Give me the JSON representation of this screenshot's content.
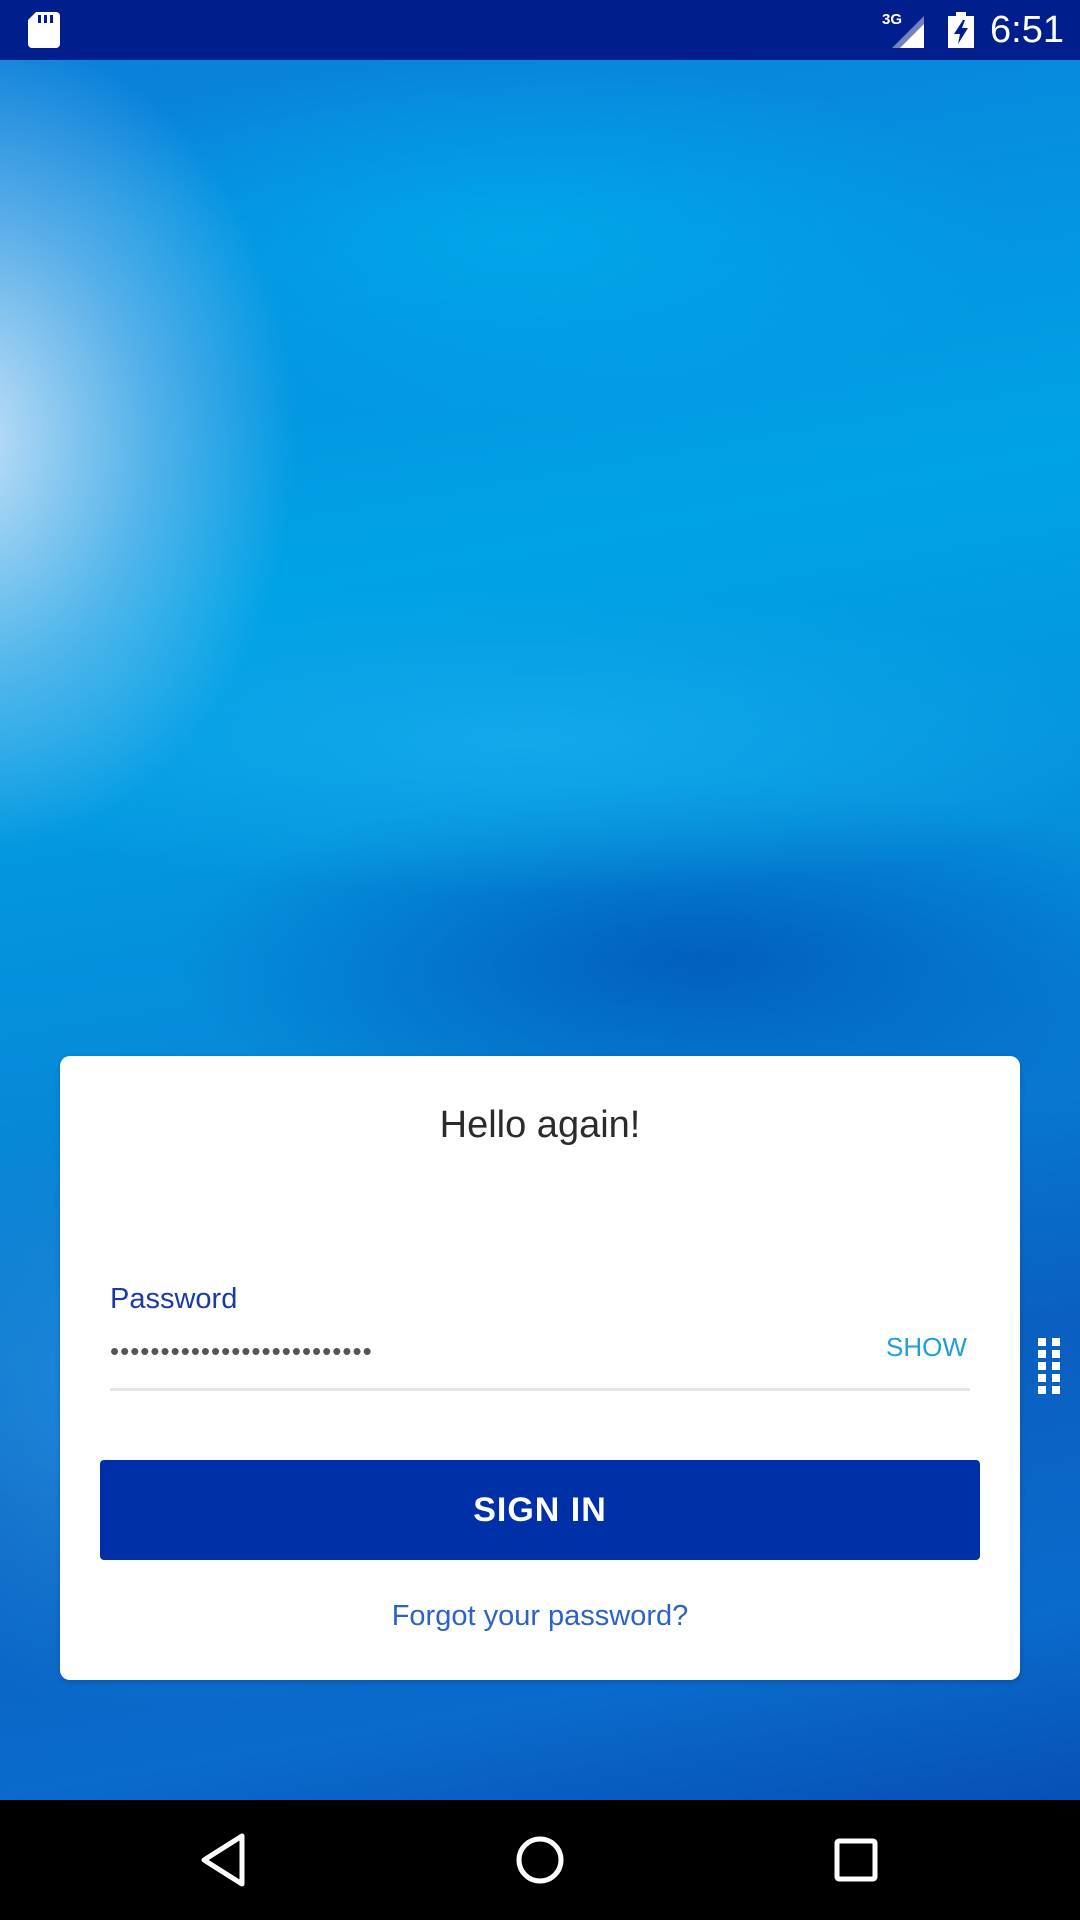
{
  "status_bar": {
    "time": "6:51",
    "network_type": "3G",
    "icons": [
      "sd-card-icon",
      "signal-icon",
      "battery-charging-icon"
    ]
  },
  "login": {
    "greeting": "Hello again!",
    "password_label": "Password",
    "password_value": "••••••••••••••••••••••••••",
    "show_label": "SHOW",
    "sign_in_label": "SIGN IN",
    "forgot_label": "Forgot your password?"
  },
  "nav_bar": {
    "icons": [
      "back-icon",
      "home-icon",
      "recents-icon"
    ]
  },
  "colors": {
    "status_bar": "#001e8c",
    "primary_button": "#0030a8",
    "label": "#1a3aa6",
    "show": "#1ea0d6",
    "link": "#2d62c9"
  }
}
